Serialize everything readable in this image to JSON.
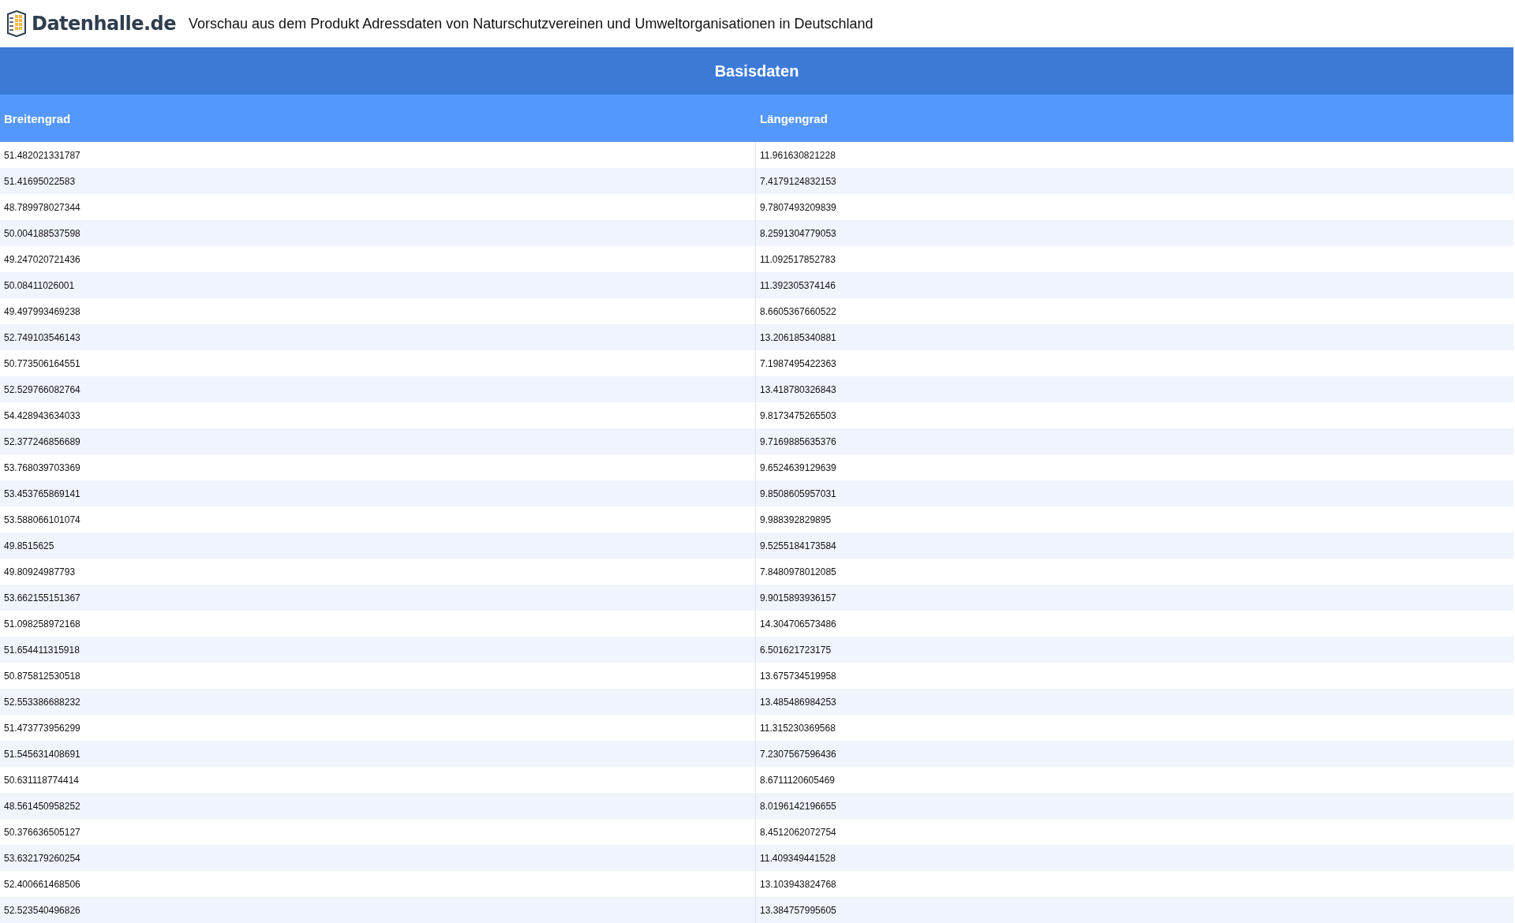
{
  "header": {
    "logo": "Datenhalle.de",
    "title": "Vorschau aus dem Produkt Adressdaten von Naturschutzvereinen und Umweltorganisationen in Deutschland"
  },
  "table": {
    "caption": "Basisdaten",
    "columns": [
      "Breitengrad",
      "Längengrad"
    ],
    "rows": [
      [
        "51.482021331787",
        "11.961630821228"
      ],
      [
        "51.41695022583",
        "7.4179124832153"
      ],
      [
        "48.789978027344",
        "9.7807493209839"
      ],
      [
        "50.004188537598",
        "8.2591304779053"
      ],
      [
        "49.247020721436",
        "11.092517852783"
      ],
      [
        "50.08411026001",
        "11.392305374146"
      ],
      [
        "49.497993469238",
        "8.6605367660522"
      ],
      [
        "52.749103546143",
        "13.206185340881"
      ],
      [
        "50.773506164551",
        "7.1987495422363"
      ],
      [
        "52.529766082764",
        "13.418780326843"
      ],
      [
        "54.428943634033",
        "9.8173475265503"
      ],
      [
        "52.377246856689",
        "9.7169885635376"
      ],
      [
        "53.768039703369",
        "9.6524639129639"
      ],
      [
        "53.453765869141",
        "9.8508605957031"
      ],
      [
        "53.588066101074",
        "9.988392829895"
      ],
      [
        "49.8515625",
        "9.5255184173584"
      ],
      [
        "49.80924987793",
        "7.8480978012085"
      ],
      [
        "53.662155151367",
        "9.9015893936157"
      ],
      [
        "51.098258972168",
        "14.304706573486"
      ],
      [
        "51.654411315918",
        "6.501621723175"
      ],
      [
        "50.875812530518",
        "13.675734519958"
      ],
      [
        "52.553386688232",
        "13.485486984253"
      ],
      [
        "51.473773956299",
        "11.315230369568"
      ],
      [
        "51.545631408691",
        "7.2307567596436"
      ],
      [
        "50.631118774414",
        "8.6711120605469"
      ],
      [
        "48.561450958252",
        "8.0196142196655"
      ],
      [
        "50.376636505127",
        "8.4512062072754"
      ],
      [
        "53.632179260254",
        "11.409349441528"
      ],
      [
        "52.400661468506",
        "13.103943824768"
      ],
      [
        "52.523540496826",
        "13.384757995605"
      ]
    ]
  }
}
